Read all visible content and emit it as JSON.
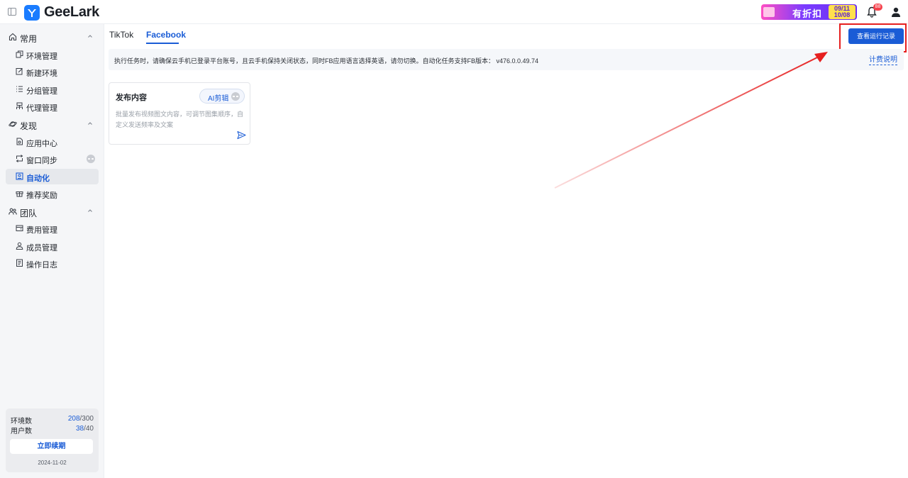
{
  "brand": {
    "name": "GeeLark"
  },
  "promo": {
    "text": "有折扣",
    "date_start": "09/11",
    "date_end": "10/08"
  },
  "notifications": {
    "count": "88"
  },
  "sidebar": {
    "groups": [
      {
        "label": "常用",
        "icon": "home-icon",
        "items": [
          {
            "label": "环境管理",
            "icon": "copy-icon"
          },
          {
            "label": "新建环境",
            "icon": "edit-icon"
          },
          {
            "label": "分组管理",
            "icon": "list-icon"
          },
          {
            "label": "代理管理",
            "icon": "network-icon"
          }
        ]
      },
      {
        "label": "发现",
        "icon": "planet-icon",
        "items": [
          {
            "label": "应用中心",
            "icon": "apps-icon"
          },
          {
            "label": "窗口同步",
            "icon": "sync-icon"
          },
          {
            "label": "自动化",
            "icon": "automation-icon"
          },
          {
            "label": "推荐奖励",
            "icon": "gift-icon"
          }
        ]
      },
      {
        "label": "团队",
        "icon": "team-icon",
        "items": [
          {
            "label": "费用管理",
            "icon": "wallet-icon"
          },
          {
            "label": "成员管理",
            "icon": "member-icon"
          },
          {
            "label": "操作日志",
            "icon": "log-icon"
          }
        ]
      }
    ]
  },
  "quota": {
    "env_label": "环境数",
    "env_used": "208",
    "env_total": "/300",
    "user_label": "用户数",
    "user_used": "38",
    "user_total": "/40",
    "renew_label": "立即续期",
    "expire_date": "2024-11-02"
  },
  "tabs": [
    {
      "label": "TikTok"
    },
    {
      "label": "Facebook"
    }
  ],
  "view_log_button": "查看运行记录",
  "notice": {
    "text": "执行任务时，请确保云手机已登录平台账号，且云手机保持关闭状态，同时FB应用语言选择英语，请勿切换。自动化任务支持FB版本： v476.0.0.49.74",
    "link": "计费说明"
  },
  "card": {
    "title": "发布内容",
    "ai_button": "AI剪辑",
    "description": "批量发布视频图文内容，可调节图集顺序，自定义发送频率及文案"
  },
  "colors": {
    "primary": "#1a5cd6",
    "annotation": "#e61f1f"
  }
}
